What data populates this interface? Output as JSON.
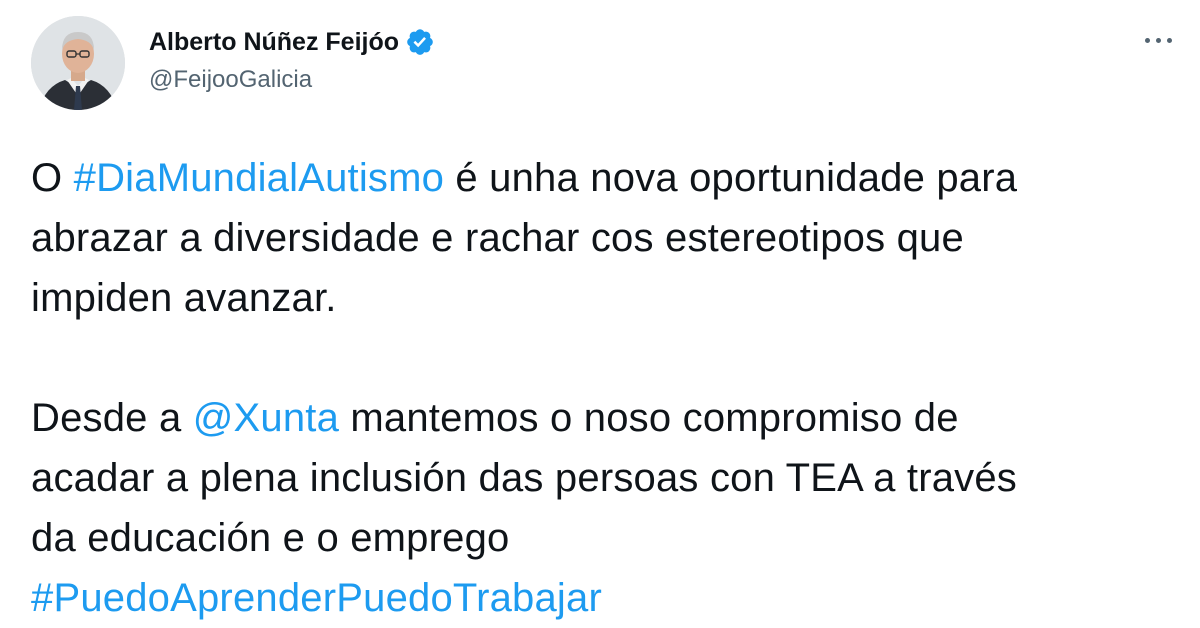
{
  "tweet": {
    "author": {
      "display_name": "Alberto Núñez Feijóo",
      "handle": "@FeijooGalicia",
      "verified": true
    },
    "more_icon": "more-horizontal-icon",
    "paragraph1": {
      "prefix": "O ",
      "hashtag": "#DiaMundialAutismo",
      "line1_rest": " é unha nova oportunidade para",
      "line2": "abrazar a diversidade e rachar cos estereotipos que",
      "line3": "impiden avanzar."
    },
    "paragraph2": {
      "prefix": "Desde a ",
      "mention": "@Xunta",
      "line1_rest": " mantemos o noso compromiso de",
      "line2": "acadar a plena inclusión das persoas con TEA a través",
      "line3": "da educación e o emprego",
      "hashtag": "#PuedoAprenderPuedoTrabajar"
    },
    "colors": {
      "text": "#0f1419",
      "secondary": "#536471",
      "link": "#1d9bf0",
      "verified_badge": "#1d9bf0"
    }
  }
}
